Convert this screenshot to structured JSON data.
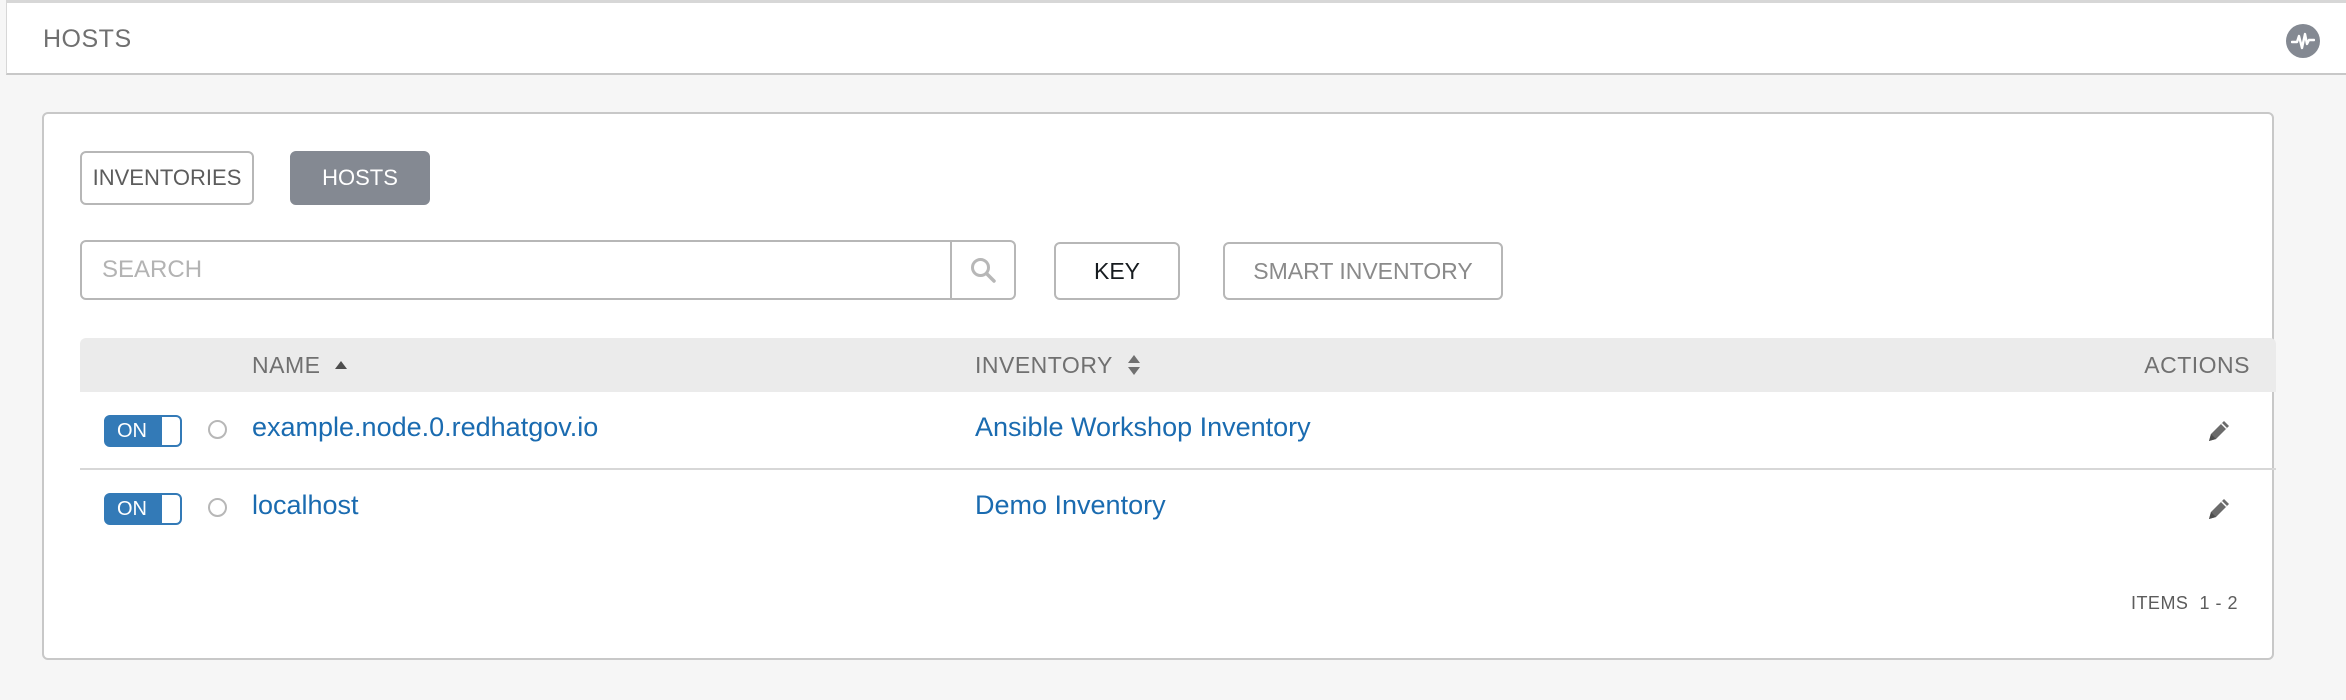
{
  "header": {
    "title": "HOSTS",
    "activity_icon": "activity-stream-icon"
  },
  "tabs": [
    {
      "label": "INVENTORIES",
      "active": false
    },
    {
      "label": "HOSTS",
      "active": true
    }
  ],
  "search": {
    "placeholder": "SEARCH",
    "value": "",
    "icon": "search-icon"
  },
  "toolbar": {
    "key_label": "KEY",
    "smart_inventory_label": "SMART INVENTORY"
  },
  "table": {
    "columns": {
      "name": "NAME",
      "inventory": "INVENTORY",
      "actions": "ACTIONS"
    },
    "rows": [
      {
        "enabled_label": "ON",
        "name": "example.node.0.redhatgov.io",
        "inventory": "Ansible Workshop Inventory",
        "edit_icon": "pencil-icon"
      },
      {
        "enabled_label": "ON",
        "name": "localhost",
        "inventory": "Demo Inventory",
        "edit_icon": "pencil-icon"
      }
    ]
  },
  "pagination": {
    "label": "ITEMS",
    "range": "1 - 2"
  },
  "colors": {
    "accent": "#337ab7",
    "link": "#1a6bb0",
    "active_tab": "#848992"
  }
}
